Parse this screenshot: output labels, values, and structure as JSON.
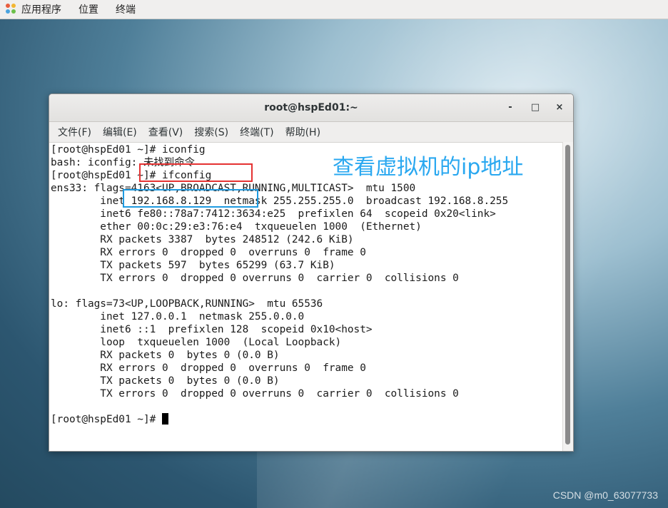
{
  "top_panel": {
    "apps": "应用程序",
    "places": "位置",
    "terminal": "终端"
  },
  "window": {
    "title": "root@hspEd01:~",
    "min": "-",
    "max": "□",
    "close": "×"
  },
  "menubar": [
    "文件(F)",
    "编辑(E)",
    "查看(V)",
    "搜索(S)",
    "终端(T)",
    "帮助(H)"
  ],
  "terminal_lines": [
    "[root@hspEd01 ~]# iconfig",
    "bash: iconfig: 未找到命令",
    "[root@hspEd01 ~]# ifconfig",
    "ens33: flags=4163<UP,BROADCAST,RUNNING,MULTICAST>  mtu 1500",
    "        inet 192.168.8.129  netmask 255.255.255.0  broadcast 192.168.8.255",
    "        inet6 fe80::78a7:7412:3634:e25  prefixlen 64  scopeid 0x20<link>",
    "        ether 00:0c:29:e3:76:e4  txqueuelen 1000  (Ethernet)",
    "        RX packets 3387  bytes 248512 (242.6 KiB)",
    "        RX errors 0  dropped 0  overruns 0  frame 0",
    "        TX packets 597  bytes 65299 (63.7 KiB)",
    "        TX errors 0  dropped 0 overruns 0  carrier 0  collisions 0",
    "",
    "lo: flags=73<UP,LOOPBACK,RUNNING>  mtu 65536",
    "        inet 127.0.0.1  netmask 255.0.0.0",
    "        inet6 ::1  prefixlen 128  scopeid 0x10<host>",
    "        loop  txqueuelen 1000  (Local Loopback)",
    "        RX packets 0  bytes 0 (0.0 B)",
    "        RX errors 0  dropped 0  overruns 0  frame 0",
    "        TX packets 0  bytes 0 (0.0 B)",
    "        TX errors 0  dropped 0 overruns 0  carrier 0  collisions 0",
    "",
    "[root@hspEd01 ~]# "
  ],
  "annotation": "查看虚拟机的ip地址",
  "watermark": "CSDN @m0_63077733",
  "colors": {
    "annotation": "#2aa8f0",
    "red_box": "#e53232",
    "blue_box": "#1e9ae0"
  }
}
